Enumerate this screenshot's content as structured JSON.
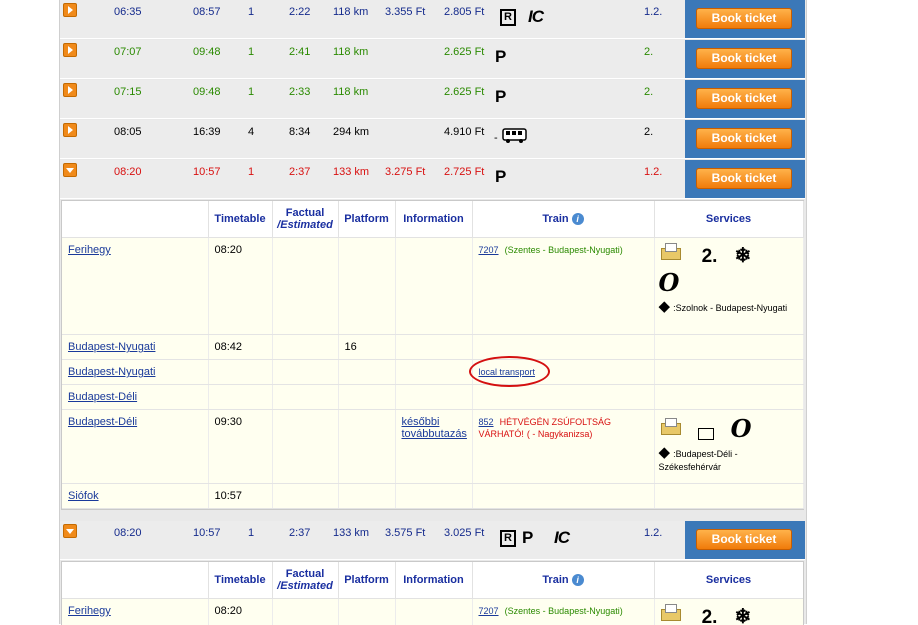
{
  "rows": [
    {
      "dep": "06:35",
      "arr": "08:57",
      "changes": "1",
      "duration": "2:22",
      "distance": "118 km",
      "price1": "3.355 Ft",
      "price2": "2.805 Ft",
      "symbols": [
        "R",
        "IC"
      ],
      "cls": "1.2.",
      "color": "navy",
      "book": "Book ticket",
      "arrow": "right"
    },
    {
      "dep": "07:07",
      "arr": "09:48",
      "changes": "1",
      "duration": "2:41",
      "distance": "118 km",
      "price1": "",
      "price2": "2.625 Ft",
      "symbols": [
        "P"
      ],
      "cls": "2.",
      "color": "green",
      "book": "Book ticket",
      "arrow": "right"
    },
    {
      "dep": "07:15",
      "arr": "09:48",
      "changes": "1",
      "duration": "2:33",
      "distance": "118 km",
      "price1": "",
      "price2": "2.625 Ft",
      "symbols": [
        "P"
      ],
      "cls": "2.",
      "color": "green",
      "book": "Book ticket",
      "arrow": "right"
    },
    {
      "dep": "08:05",
      "arr": "16:39",
      "changes": "4",
      "duration": "8:34",
      "distance": "294 km",
      "price1": "",
      "price2": "4.910 Ft",
      "symbols": [
        "-",
        "bus"
      ],
      "cls": "2.",
      "color": "black",
      "book": "Book ticket",
      "arrow": "right"
    },
    {
      "dep": "08:20",
      "arr": "10:57",
      "changes": "1",
      "duration": "2:37",
      "distance": "133 km",
      "price1": "3.275 Ft",
      "price2": "2.725 Ft",
      "symbols": [
        "P"
      ],
      "cls": "1.2.",
      "color": "red",
      "book": "Book ticket",
      "arrow": "down"
    }
  ],
  "headers": {
    "station": "",
    "timetable": "Timetable",
    "factual": "Factual",
    "estimated": "/Estimated",
    "platform": "Platform",
    "information": "Information",
    "train": "Train",
    "services": "Services"
  },
  "detail1": {
    "stops": [
      {
        "station": "Ferihegy",
        "time": "08:20",
        "platform": "",
        "info": "",
        "train_no": "7207",
        "train_desc": "(Szentes - Budapest-Nyugati)",
        "services_class": "2.",
        "services_route": ":Szolnok - Budapest-Nyugati"
      },
      {
        "station": "Budapest-Nyugati",
        "time": "08:42",
        "platform": "16"
      },
      {
        "station": "Budapest-Nyugati",
        "time": "",
        "platform": "",
        "train_link": "local transport"
      },
      {
        "station": "Budapest-Déli",
        "time": "",
        "platform": ""
      },
      {
        "station": "Budapest-Déli",
        "time": "09:30",
        "platform": "",
        "info": "későbbi továbbutazás",
        "train_no": "852",
        "train_desc_red": "HÉTVÉGÉN ZSÚFOLTSÁG VÁRHATÓ!",
        "train_desc2": "( - Nagykanizsa)",
        "services_route": ":Budapest-Déli - Székesfehérvár"
      },
      {
        "station": "Siófok",
        "time": "10:57"
      }
    ]
  },
  "row6": {
    "dep": "08:20",
    "arr": "10:57",
    "changes": "1",
    "duration": "2:37",
    "distance": "133 km",
    "price1": "3.575 Ft",
    "price2": "3.025 Ft",
    "symbols": [
      "R",
      "P",
      "IC"
    ],
    "cls": "1.2.",
    "color": "navy",
    "book": "Book ticket"
  },
  "detail2": {
    "station": "Ferihegy",
    "time": "08:20",
    "train_no": "7207",
    "train_desc": "(Szentes - Budapest-Nyugati)",
    "services_class": "2."
  }
}
